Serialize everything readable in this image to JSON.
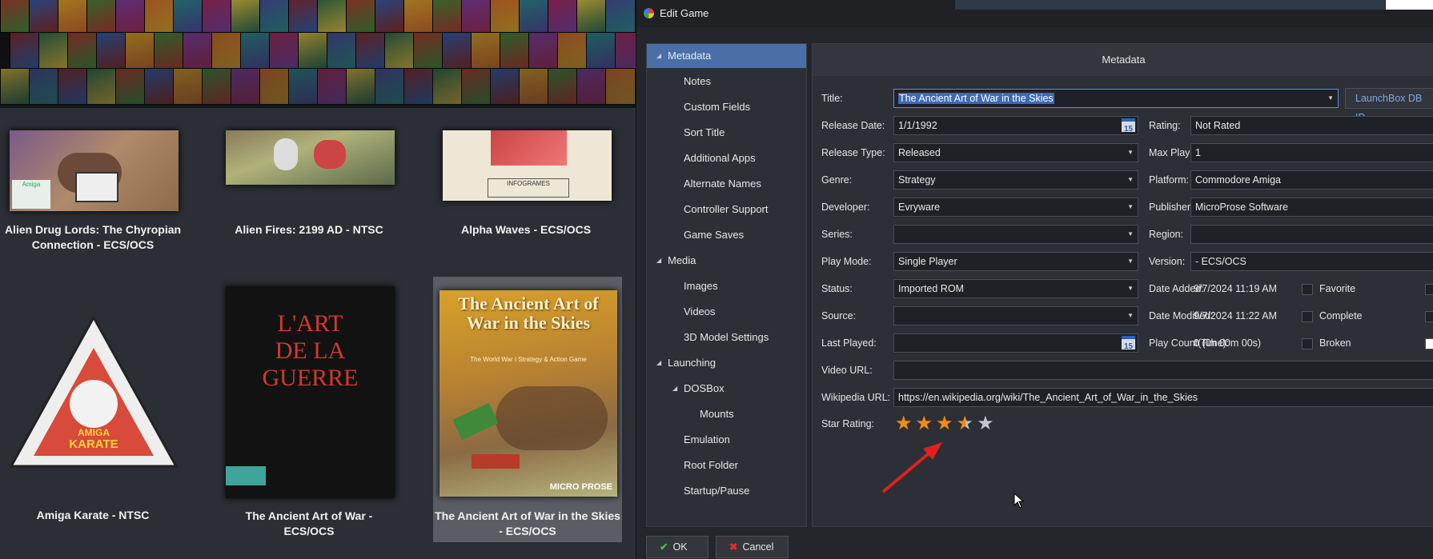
{
  "dialog": {
    "title": "Edit Game",
    "header": "Metadata",
    "tree": [
      {
        "label": "Metadata",
        "level": 0,
        "expandable": true,
        "selected": true
      },
      {
        "label": "Notes",
        "level": 1
      },
      {
        "label": "Custom Fields",
        "level": 1
      },
      {
        "label": "Sort Title",
        "level": 1
      },
      {
        "label": "Additional Apps",
        "level": 1
      },
      {
        "label": "Alternate Names",
        "level": 1
      },
      {
        "label": "Controller Support",
        "level": 1
      },
      {
        "label": "Game Saves",
        "level": 1
      },
      {
        "label": "Media",
        "level": 0,
        "expandable": true
      },
      {
        "label": "Images",
        "level": 1
      },
      {
        "label": "Videos",
        "level": 1
      },
      {
        "label": "3D Model Settings",
        "level": 1
      },
      {
        "label": "Launching",
        "level": 0,
        "expandable": true
      },
      {
        "label": "DOSBox",
        "level": 1,
        "expandable": true
      },
      {
        "label": "Mounts",
        "level": 2
      },
      {
        "label": "Emulation",
        "level": 1
      },
      {
        "label": "Root Folder",
        "level": 1
      },
      {
        "label": "Startup/Pause",
        "level": 1
      }
    ],
    "fields": {
      "title": {
        "label": "Title:",
        "value": "The Ancient Art of War in the Skies"
      },
      "launchbox_db": "LaunchBox DB ID",
      "release_date": {
        "label": "Release Date:",
        "value": "1/1/1992"
      },
      "release_type": {
        "label": "Release Type:",
        "value": "Released"
      },
      "genre": {
        "label": "Genre:",
        "value": "Strategy"
      },
      "developer": {
        "label": "Developer:",
        "value": "Evryware"
      },
      "series": {
        "label": "Series:",
        "value": ""
      },
      "play_mode": {
        "label": "Play Mode:",
        "value": "Single Player"
      },
      "status": {
        "label": "Status:",
        "value": "Imported ROM"
      },
      "source": {
        "label": "Source:",
        "value": ""
      },
      "last_played": {
        "label": "Last Played:",
        "value": ""
      },
      "video_url": {
        "label": "Video URL:",
        "value": ""
      },
      "wikipedia_url": {
        "label": "Wikipedia URL:",
        "value": "https://en.wikipedia.org/wiki/The_Ancient_Art_of_War_in_the_Skies"
      },
      "star_rating": {
        "label": "Star Rating:",
        "value": 3.5,
        "max": 5
      },
      "rating": {
        "label": "Rating:",
        "value": "Not Rated"
      },
      "max_players": {
        "label": "Max Players:",
        "value": "1"
      },
      "platform": {
        "label": "Platform:",
        "value": "Commodore Amiga"
      },
      "publisher": {
        "label": "Publisher:",
        "value": "MicroProse Software"
      },
      "region": {
        "label": "Region:",
        "value": ""
      },
      "version": {
        "label": "Version:",
        "value": "- ECS/OCS"
      },
      "date_added": {
        "label": "Date Added:",
        "value": "9/7/2024 11:19 AM"
      },
      "date_modified": {
        "label": "Date Modified:",
        "value": "9/7/2024 11:22 AM"
      },
      "play_count": {
        "label": "Play Count(Time):",
        "value": "0 (0h 00m 00s)"
      }
    },
    "checkboxes": {
      "favorite": "Favorite",
      "complete": "Complete",
      "broken": "Broken"
    },
    "calendar_day": "15",
    "buttons": {
      "ok": "OK",
      "cancel": "Cancel"
    }
  },
  "games": [
    {
      "title": "Alien Drug Lords: The Chyropian Connection - ECS/OCS"
    },
    {
      "title": "Alien Fires: 2199 AD - NTSC"
    },
    {
      "title": "Alpha Waves - ECS/OCS"
    },
    {
      "title": "Amiga Karate - NTSC"
    },
    {
      "title": "The Ancient Art of War - ECS/OCS"
    },
    {
      "title": "The Ancient Art of War in the Skies - ECS/OCS",
      "selected": true
    }
  ],
  "covers": {
    "c1_badge": "Amiga",
    "c3_brand": "INFOGRAMES",
    "c4_line1": "AMIGA",
    "c4_line2": "KARATE",
    "c5_line1": "L'ART",
    "c5_line2": "DE LA",
    "c5_line3": "GUERRE",
    "c6_title": "The Ancient Art of War in the Skies",
    "c6_sub": "The World War I Strategy & Action Game",
    "c6_brand": "MICRO PROSE"
  },
  "colors": {
    "accent": "#4a6fa8",
    "star": "#f08b1c",
    "arrow": "#e0201c"
  }
}
